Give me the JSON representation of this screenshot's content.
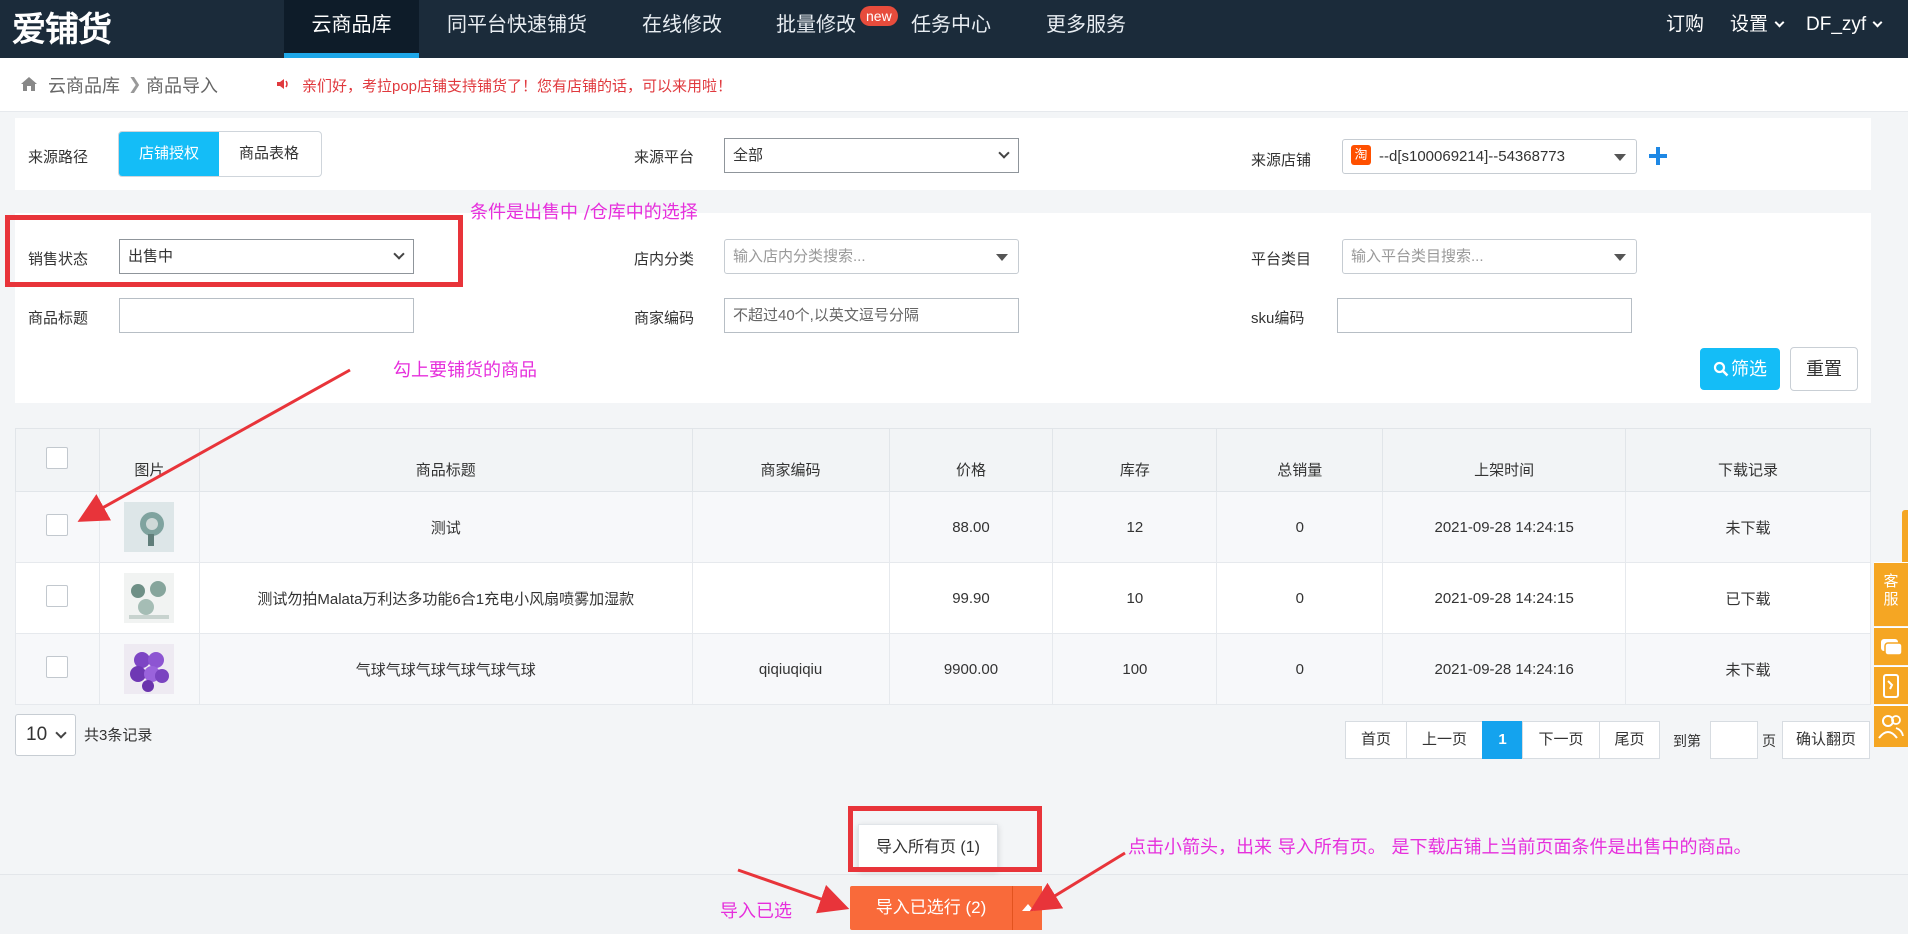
{
  "logo": "爱铺货",
  "topnav": {
    "items": [
      "云商品库",
      "同平台快速铺货",
      "在线修改",
      "批量修改",
      "任务中心",
      "更多服务"
    ],
    "new_badge": "new",
    "right": {
      "subscribe": "订购",
      "settings": "设置",
      "user": "DF_zyf"
    }
  },
  "breadcrumb": {
    "home": "云商品库",
    "current": "商品导入"
  },
  "notice": "亲们好，考拉pop店铺支持铺货了！您有店铺的话，可以来用啦！",
  "filters": {
    "source_path_label": "来源路径",
    "source_path_tabs": [
      "店铺授权",
      "商品表格"
    ],
    "source_platform_label": "来源平台",
    "source_platform_value": "全部",
    "source_store_label": "来源店铺",
    "source_store_value": "--d[s100069214]--54368773",
    "taobao_char": "淘",
    "sale_status_label": "销售状态",
    "sale_status_value": "出售中",
    "store_category_label": "店内分类",
    "store_category_placeholder": "输入店内分类搜索...",
    "platform_category_label": "平台类目",
    "platform_category_placeholder": "输入平台类目搜索...",
    "title_label": "商品标题",
    "merchant_code_label": "商家编码",
    "merchant_code_placeholder": "不超过40个,以英文逗号分隔",
    "sku_label": "sku编码",
    "filter_button": "筛选",
    "reset_button": "重置"
  },
  "table": {
    "headers": [
      "图片",
      "商品标题",
      "商家编码",
      "价格",
      "库存",
      "总销量",
      "上架时间",
      "下载记录"
    ],
    "rows": [
      {
        "title": "测试",
        "code": "",
        "price": "88.00",
        "stock": "12",
        "sales": "0",
        "time": "2021-09-28 14:24:15",
        "status": "未下载"
      },
      {
        "title": "测试勿拍Malata万利达多功能6合1充电小风扇喷雾加湿款",
        "code": "",
        "price": "99.90",
        "stock": "10",
        "sales": "0",
        "time": "2021-09-28 14:24:15",
        "status": "已下载"
      },
      {
        "title": "气球气球气球气球气球气球",
        "code": "qiqiuqiqiu",
        "price": "9900.00",
        "stock": "100",
        "sales": "0",
        "time": "2021-09-28 14:24:16",
        "status": "未下载"
      }
    ]
  },
  "pagination": {
    "page_size": "10",
    "total": "共3条记录",
    "first": "首页",
    "prev": "上一页",
    "current": "1",
    "next": "下一页",
    "last": "尾页",
    "goto_prefix": "到第",
    "goto_suffix": "页",
    "confirm": "确认翻页"
  },
  "bottom": {
    "import_all_pages": "导入所有页 (1)",
    "import_selected": "导入已选行 (2)"
  },
  "side": {
    "service": "客服"
  },
  "annotations": {
    "status_note": "条件是出售中 /仓库中的选择",
    "check_note": "勾上要铺货的商品",
    "arrow_note": "点击小箭头，出来 导入所有页。 是下载店铺上当前页面条件是出售中的商品。",
    "import_note": "导入已选"
  },
  "colors": {
    "nav_bg": "#1b2b3a",
    "accent": "#14bdf7",
    "import": "#f96a3a",
    "annotation": "#e62fdc",
    "highlight_box": "#e8343a"
  }
}
